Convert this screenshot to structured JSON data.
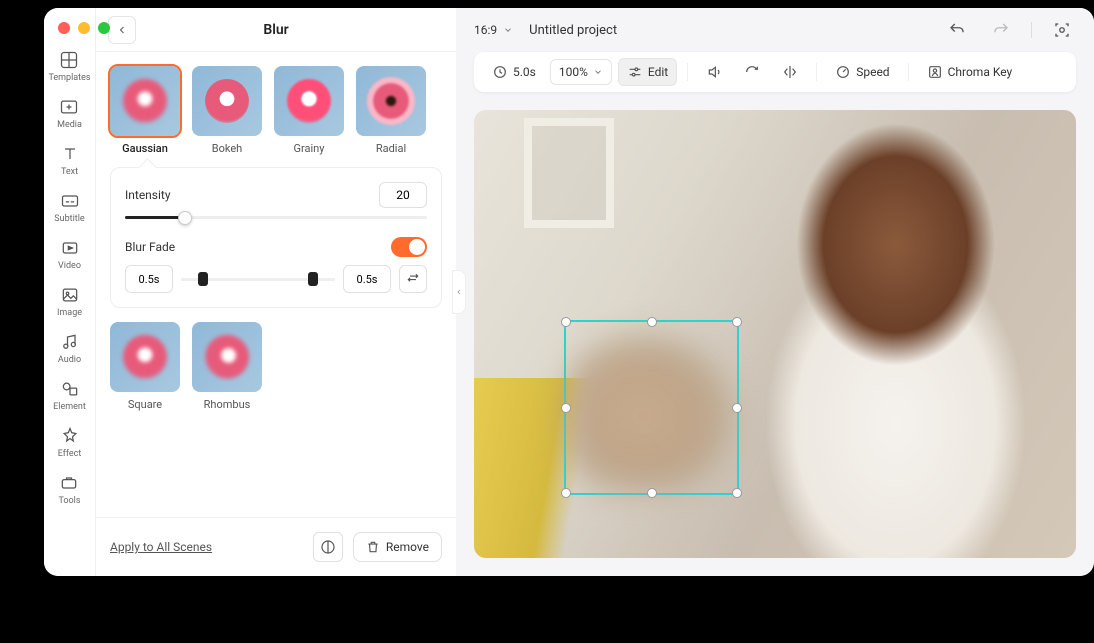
{
  "panel": {
    "title": "Blur",
    "blur_types": [
      {
        "name": "Gaussian",
        "active": true
      },
      {
        "name": "Bokeh",
        "active": false
      },
      {
        "name": "Grainy",
        "active": false
      },
      {
        "name": "Radial",
        "active": false
      }
    ],
    "shape_types": [
      {
        "name": "Square"
      },
      {
        "name": "Rhombus"
      }
    ],
    "intensity_label": "Intensity",
    "intensity_value": "20",
    "blur_fade_label": "Blur Fade",
    "fade_in": "0.5s",
    "fade_out": "0.5s",
    "apply_all": "Apply to All Scenes",
    "remove": "Remove"
  },
  "sidebar": {
    "items": [
      {
        "label": "Templates"
      },
      {
        "label": "Media"
      },
      {
        "label": "Text"
      },
      {
        "label": "Subtitle"
      },
      {
        "label": "Video"
      },
      {
        "label": "Image"
      },
      {
        "label": "Audio"
      },
      {
        "label": "Element"
      },
      {
        "label": "Effect"
      },
      {
        "label": "Tools"
      }
    ]
  },
  "header": {
    "aspect": "16:9",
    "project": "Untitled project"
  },
  "toolbar": {
    "duration": "5.0s",
    "zoom": "100%",
    "edit": "Edit",
    "speed": "Speed",
    "chroma": "Chroma Key"
  }
}
